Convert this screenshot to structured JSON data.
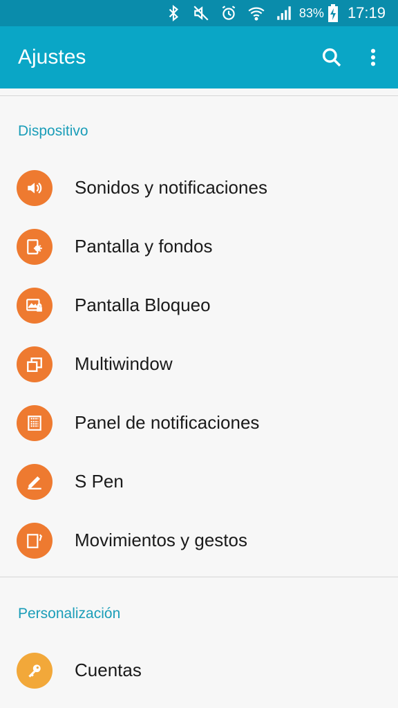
{
  "status_bar": {
    "battery": "83%",
    "time": "17:19",
    "icons": [
      "bluetooth-icon",
      "vibrate-mute-icon",
      "alarm-icon",
      "wifi-icon",
      "signal-icon",
      "battery-charging-icon"
    ]
  },
  "app_bar": {
    "title": "Ajustes",
    "actions": [
      "search-icon",
      "more-vert-icon"
    ]
  },
  "sections": [
    {
      "header": "Dispositivo",
      "items": [
        {
          "label": "Sonidos y notificaciones",
          "icon": "speaker-icon",
          "color": "#ee7a30"
        },
        {
          "label": "Pantalla y fondos",
          "icon": "display-brightness-icon",
          "color": "#ee7a30"
        },
        {
          "label": "Pantalla Bloqueo",
          "icon": "lock-screen-icon",
          "color": "#ee7a30"
        },
        {
          "label": "Multiwindow",
          "icon": "multiwindow-icon",
          "color": "#ee7a30"
        },
        {
          "label": "Panel de notificaciones",
          "icon": "notification-panel-icon",
          "color": "#ee7a30"
        },
        {
          "label": "S Pen",
          "icon": "pen-icon",
          "color": "#ee7a30"
        },
        {
          "label": "Movimientos y gestos",
          "icon": "motion-icon",
          "color": "#ee7a30"
        }
      ]
    },
    {
      "header": "Personalización",
      "items": [
        {
          "label": "Cuentas",
          "icon": "key-icon",
          "color": "#f2a83a"
        }
      ]
    }
  ],
  "colors": {
    "status_bar": "#0a8cab",
    "app_bar": "#0aa6c6",
    "section_header": "#1a9db8",
    "background": "#f7f7f7"
  }
}
